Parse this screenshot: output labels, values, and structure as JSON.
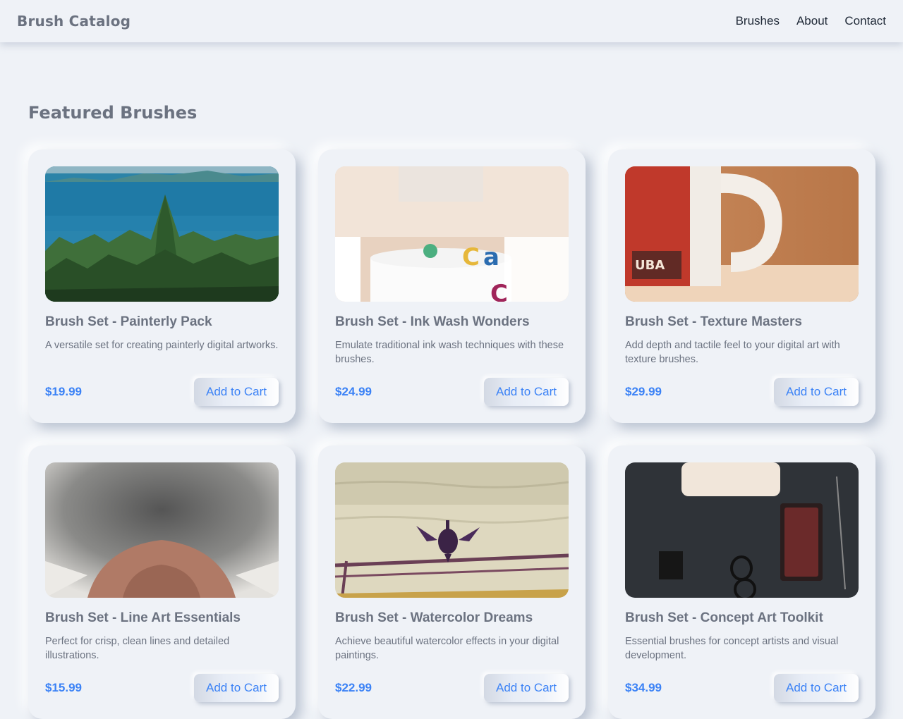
{
  "header": {
    "brand": "Brush Catalog",
    "nav": [
      "Brushes",
      "About",
      "Contact"
    ]
  },
  "main": {
    "section_title": "Featured Brushes",
    "products": [
      {
        "title": "Brush Set - Painterly Pack",
        "description": "A versatile set for creating painterly digital artworks.",
        "price": "$19.99",
        "button": "Add to Cart",
        "image": "forest-lake-photo"
      },
      {
        "title": "Brush Set - Ink Wash Wonders",
        "description": "Emulate traditional ink wash techniques with these brushes.",
        "price": "$24.99",
        "button": "Add to Cart",
        "image": "mug-desk-photo"
      },
      {
        "title": "Brush Set - Texture Masters",
        "description": "Add depth and tactile feel to your digital art with texture brushes.",
        "price": "$29.99",
        "button": "Add to Cart",
        "image": "red-mug-photo"
      },
      {
        "title": "Brush Set - Line Art Essentials",
        "description": "Perfect for crisp, clean lines and detailed illustrations.",
        "price": "$15.99",
        "button": "Add to Cart",
        "image": "cat-nose-photo"
      },
      {
        "title": "Brush Set - Watercolor Dreams",
        "description": "Achieve beautiful watercolor effects in your digital paintings.",
        "price": "$22.99",
        "button": "Add to Cart",
        "image": "cormorant-photo"
      },
      {
        "title": "Brush Set - Concept Art Toolkit",
        "description": "Essential brushes for concept artists and visual development.",
        "price": "$34.99",
        "button": "Add to Cart",
        "image": "dark-desk-photo"
      }
    ]
  },
  "colors": {
    "background": "#eff2f7",
    "text": "#6b7280",
    "accent": "#3b82f6",
    "nav_text": "#1f2937"
  }
}
